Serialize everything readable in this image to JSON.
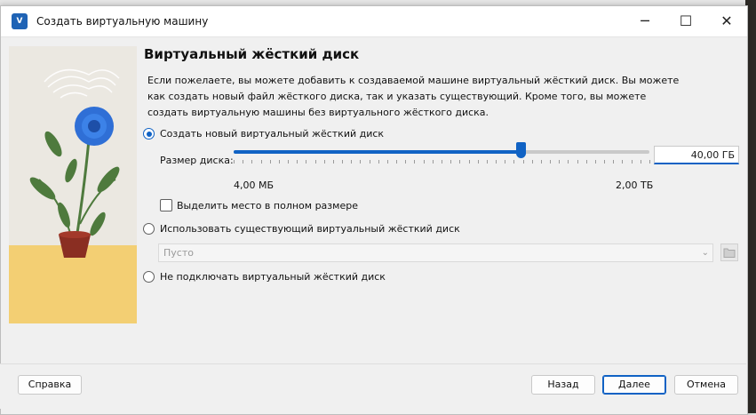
{
  "window": {
    "title": "Создать виртуальную машину",
    "app_icon_text": "V"
  },
  "page": {
    "heading": "Виртуальный жёсткий диск",
    "description": "Если пожелаете, вы можете добавить к создаваемой машине виртуальный жёсткий диск. Вы можете как создать новый файл жёсткого диска, так и указать существующий. Кроме того, вы можете создать виртуальную машины без виртуального жёсткого диска."
  },
  "options": {
    "create_new": {
      "label": "Создать новый виртуальный жёсткий диск",
      "checked": true
    },
    "use_existing": {
      "label": "Использовать существующий виртуальный жёсткий диск",
      "checked": false
    },
    "no_disk": {
      "label": "Не подключать виртуальный жёсткий диск",
      "checked": false
    }
  },
  "disk_size": {
    "label": "Размер диска:",
    "value": "40,00 ГБ",
    "min_label": "4,00 МБ",
    "max_label": "2,00 ТБ",
    "slider_fraction": 0.69
  },
  "preallocate": {
    "label": "Выделить место в полном размере",
    "checked": false
  },
  "existing_disk": {
    "value": "Пусто"
  },
  "footer": {
    "help": "Справка",
    "back": "Назад",
    "next": "Далее",
    "cancel": "Отмена"
  },
  "colors": {
    "accent": "#1062c4",
    "flower": "#2f6fd6",
    "leaves": "#4e7a3d",
    "pot": "#8a2e22",
    "floor": "#f3cf73"
  }
}
